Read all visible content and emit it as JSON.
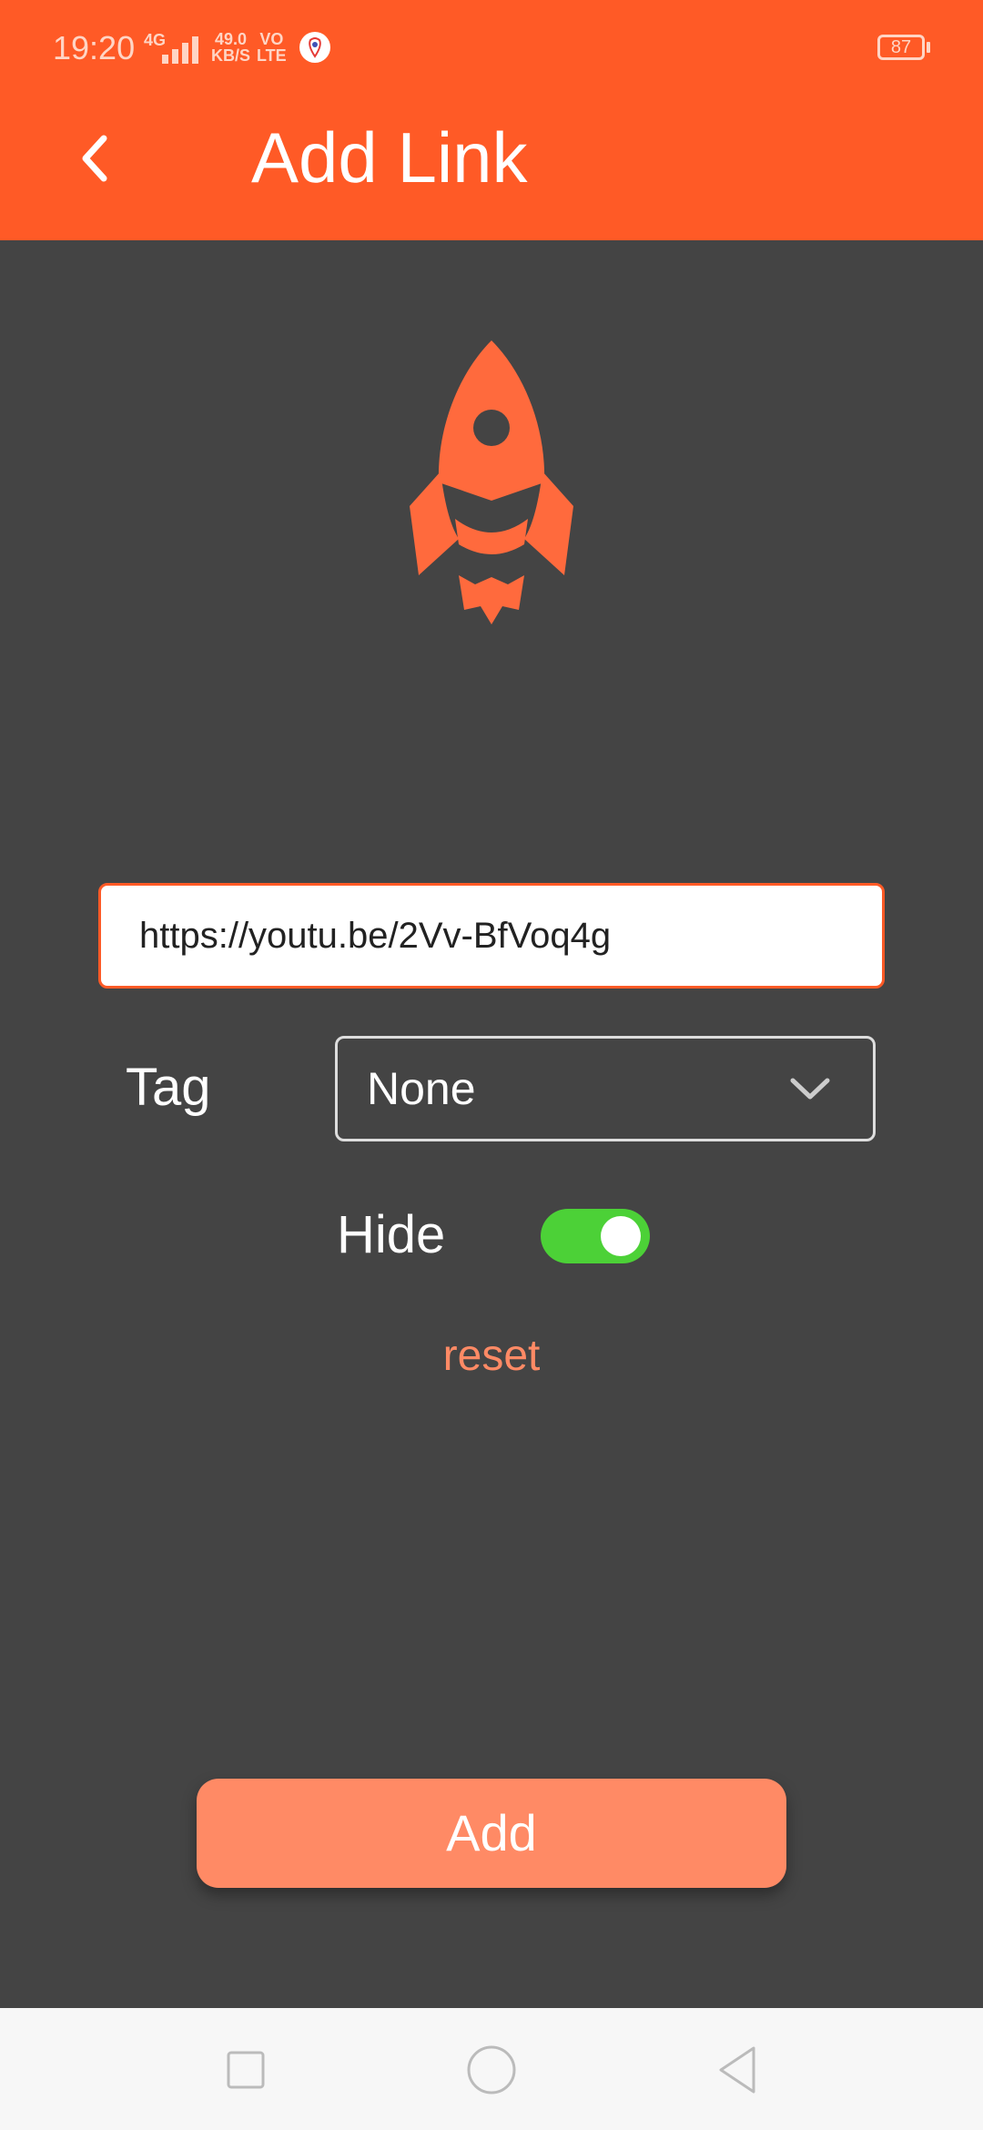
{
  "status_bar": {
    "time": "19:20",
    "network_type": "4G",
    "net_speed_value": "49.0",
    "net_speed_unit": "KB/S",
    "volte_top": "VO",
    "volte_bottom": "LTE",
    "battery": "87"
  },
  "header": {
    "back_icon": "chevron-left-icon",
    "title": "Add Link"
  },
  "hero": {
    "icon": "rocket-icon"
  },
  "form": {
    "url_value": "https://youtu.be/2Vv-BfVoq4g",
    "tag_label": "Tag",
    "tag_selected": "None",
    "hide_label": "Hide",
    "hide_enabled": true,
    "reset_label": "reset",
    "add_label": "Add"
  },
  "colors": {
    "app_bar": "#FF5A26",
    "background": "#444444",
    "accent": "#FF8A65",
    "toggle_on": "#4CD137"
  },
  "nav": {
    "items": [
      "recent-apps-icon",
      "home-icon",
      "back-icon"
    ]
  }
}
